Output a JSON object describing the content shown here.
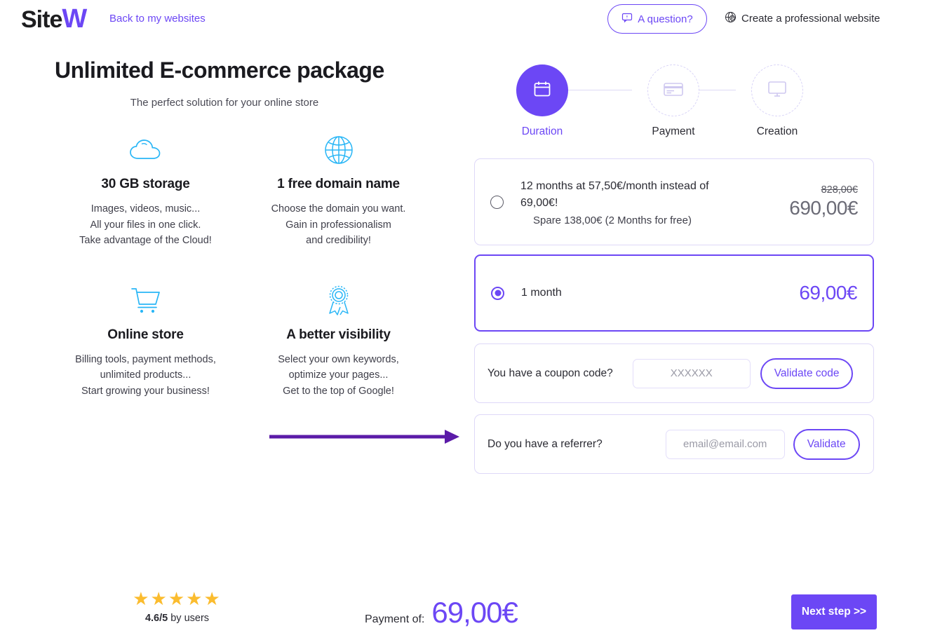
{
  "header": {
    "logo_text": "Site",
    "logo_accent": "W",
    "back_link": "Back to my websites",
    "question_button": "A question?",
    "question_icon": "chat-bubble-icon",
    "create_pro_label": "Create a professional website",
    "create_pro_icon": "globe-badge-icon"
  },
  "hero": {
    "title": "Unlimited E-commerce package",
    "subtitle": "The perfect solution for your online store"
  },
  "features": [
    {
      "icon": "cloud-icon",
      "title": "30 GB storage",
      "line1": "Images, videos, music...",
      "line2": "All your files in one click.",
      "line3": "Take advantage of the Cloud!"
    },
    {
      "icon": "globe-icon",
      "title": "1 free domain name",
      "line1": "Choose the domain you want.",
      "line2": "Gain in professionalism",
      "line3": "and credibility!"
    },
    {
      "icon": "shopping-cart-icon",
      "title": "Online store",
      "line1": "Billing tools, payment methods,",
      "line2": "unlimited products...",
      "line3": "Start growing your business!"
    },
    {
      "icon": "award-ribbon-icon",
      "title": "A better visibility",
      "line1": "Select your own keywords,",
      "line2": "optimize your pages...",
      "line3": "Get to the top of Google!"
    }
  ],
  "stepper": {
    "steps": [
      {
        "label": "Duration",
        "icon": "calendar-icon",
        "state": "active"
      },
      {
        "label": "Payment",
        "icon": "credit-card-icon",
        "state": "idle"
      },
      {
        "label": "Creation",
        "icon": "monitor-icon",
        "state": "idle"
      }
    ]
  },
  "plans": [
    {
      "id": "plan-12-months",
      "selected": false,
      "line1": "12 months at 57,50€/month instead of 69,00€!",
      "line2": "Spare 138,00€ (2 Months for free)",
      "old_price": "828,00€",
      "price": "690,00€"
    },
    {
      "id": "plan-1-month",
      "selected": true,
      "line1": "1 month",
      "line2": "",
      "old_price": "",
      "price": "69,00€"
    }
  ],
  "coupon": {
    "label": "You have a coupon code?",
    "input_value": "",
    "input_placeholder": "XXXXXX",
    "button": "Validate code"
  },
  "referrer": {
    "label": "Do you have a referrer?",
    "input_value": "",
    "input_placeholder": "email@email.com",
    "button": "Validate"
  },
  "annotation": {
    "type": "arrow-right",
    "color": "#5B1BA8"
  },
  "footer": {
    "stars": "★★★★★",
    "rating_score": "4.6",
    "rating_max": "/5",
    "rating_suffix": " by users",
    "payment_label": "Payment of:",
    "payment_amount": "69,00€",
    "next_button": "Next step >>"
  },
  "colors": {
    "accent_purple": "#6C47F5",
    "icon_blue": "#29B6F6",
    "star_yellow": "#FBBC2E",
    "annotation_purple": "#5B1BA8"
  }
}
